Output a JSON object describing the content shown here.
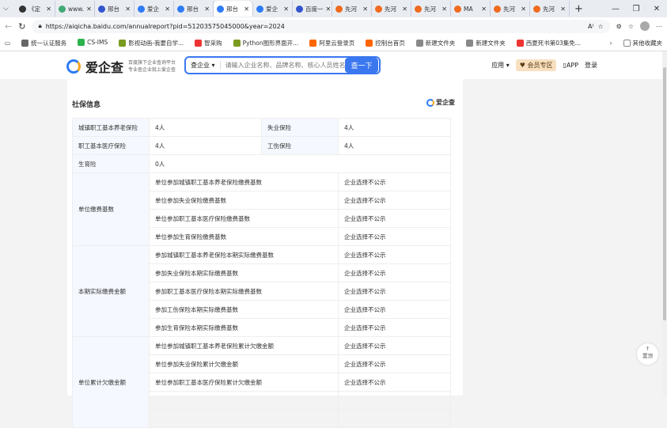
{
  "browser": {
    "tabs": [
      {
        "label": "《定",
        "c": "#333"
      },
      {
        "label": "www.",
        "c": "#4a7"
      },
      {
        "label": "邢台",
        "c": "#3355cc"
      },
      {
        "label": "爱企",
        "c": "#2e7bf6"
      },
      {
        "label": "邢台",
        "c": "#2e7bf6"
      },
      {
        "label": "邢台",
        "c": "#2e7bf6"
      },
      {
        "label": "爱企",
        "c": "#2e7bf6"
      },
      {
        "label": "百度一",
        "c": "#3355cc"
      },
      {
        "label": "先河",
        "c": "#f06a1f"
      },
      {
        "label": "先河",
        "c": "#f06a1f"
      },
      {
        "label": "先河",
        "c": "#f06a1f"
      },
      {
        "label": "MA",
        "c": "#f06a1f"
      },
      {
        "label": "先河",
        "c": "#f06a1f"
      },
      {
        "label": "先河",
        "c": "#f06a1f"
      }
    ],
    "active_tab": 5,
    "url": "https://aiqicha.baidu.com/annualreport?pid=51203575045000&year=2024",
    "bookmarks": [
      {
        "label": "统一认证服务",
        "c": "#666"
      },
      {
        "label": "CS-IMS",
        "c": "#2bb24c"
      },
      {
        "label": "影视动画-我要自学...",
        "c": "#7a9a20"
      },
      {
        "label": "智采购",
        "c": "#e33"
      },
      {
        "label": "Python图形界面开...",
        "c": "#7a9a20"
      },
      {
        "label": "阿里云登录页",
        "c": "#f60"
      },
      {
        "label": "控制台首页",
        "c": "#f60"
      },
      {
        "label": "新建文件夹",
        "c": "#888"
      },
      {
        "label": "新建文件夹",
        "c": "#888"
      },
      {
        "label": "西夏死书第03集免...",
        "c": "#e33"
      }
    ],
    "other_bookmarks": "其他收藏夹"
  },
  "header": {
    "logo": "爱企查",
    "slogan1": "百度旗下企业查询平台",
    "slogan2": "专业查企业就上爱企查",
    "search_type": "查企业 ▾",
    "search_placeholder": "请输入企业名称、品牌名称、核心人员姓名",
    "search_button": "查一下",
    "apps": "应用 ▾",
    "vip": "♥ 会员专区",
    "app": "APP",
    "login": "登录"
  },
  "section": {
    "title": "社保信息",
    "watermark": "爱企查"
  },
  "table": {
    "top_rows": [
      [
        "城镇职工基本养老保险",
        "4人",
        "失业保险",
        "4人"
      ],
      [
        "职工基本医疗保险",
        "4人",
        "工伤保险",
        "4人"
      ]
    ],
    "maternity": [
      "生育险",
      "0人"
    ],
    "groups": [
      {
        "label": "单位缴费基数",
        "rows": [
          [
            "单位参加城镇职工基本养老保险缴费基数",
            "企业选择不公示"
          ],
          [
            "单位参加失业保险缴费基数",
            "企业选择不公示"
          ],
          [
            "单位参加职工基本医疗保险缴费基数",
            "企业选择不公示"
          ],
          [
            "单位参加生育保险缴费基数",
            "企业选择不公示"
          ]
        ]
      },
      {
        "label": "本期实际缴费金额",
        "rows": [
          [
            "参加城镇职工基本养老保险本期实际缴费基数",
            "企业选择不公示"
          ],
          [
            "参加失业保险本期实际缴费基数",
            "企业选择不公示"
          ],
          [
            "参加职工基本医疗保险本期实际缴费基数",
            "企业选择不公示"
          ],
          [
            "参加工伤保险本期实际缴费基数",
            "企业选择不公示"
          ],
          [
            "参加生育保险本期实际缴费基数",
            "企业选择不公示"
          ]
        ]
      },
      {
        "label": "单位累计欠缴金额",
        "rows": [
          [
            "单位参加城镇职工基本养老保险累计欠缴金额",
            "企业选择不公示"
          ],
          [
            "单位参加失业保险累计欠缴金额",
            "企业选择不公示"
          ],
          [
            "单位参加职工基本医疗保险累计欠缴金额",
            "企业选择不公示"
          ]
        ]
      }
    ]
  },
  "back_to_top": {
    "arrow": "↑",
    "label": "置顶"
  }
}
